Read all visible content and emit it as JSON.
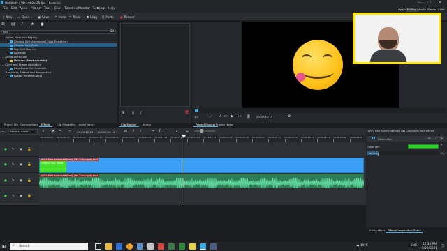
{
  "window": {
    "title": "Untitled* / HD 1080p 25 fps – Kdenlive",
    "controls": [
      "—",
      "❐",
      "✕"
    ]
  },
  "menu": [
    "File",
    "Edit",
    "View",
    "Project",
    "Tool",
    "Clip",
    "Timeline",
    "Monitor",
    "Settings",
    "Help"
  ],
  "layouts": [
    "Logging",
    "Editing",
    "Audio",
    "Effects",
    "Color"
  ],
  "toolbar": {
    "new": "New",
    "open": "Open...",
    "save": "Save",
    "undo": "Undo",
    "redo": "Redo",
    "copy": "Copy",
    "paste": "Paste",
    "render": "Render"
  },
  "effects": {
    "search_value": "key",
    "groups": [
      {
        "label": "Alpha, Mask and Keying",
        "items": [
          {
            "label": "Chroma Key: Advanced (Color Selection)",
            "color": "#3daee9",
            "selected": false
          },
          {
            "label": "Chroma Key: Basic",
            "color": "#3daee9",
            "selected": true
          },
          {
            "label": "Key Spill Mop Up",
            "color": "#3daee9",
            "selected": false
          },
          {
            "label": "Lumakey",
            "color": "#3daee9",
            "selected": false
          }
        ]
      },
      {
        "label": "Audio correction",
        "items": [
          {
            "label": "Volume (keyframable)",
            "color": "#e8c32f",
            "selected": false,
            "bold": true
          }
        ]
      },
      {
        "label": "Color and Image correction",
        "items": [
          {
            "label": "Brightness (keyframable)",
            "color": "#3daee9",
            "selected": false
          }
        ]
      },
      {
        "label": "Transform, Distort and Perspective",
        "items": [
          {
            "label": "Rotate (keyframable)",
            "color": "#3daee9",
            "selected": false
          }
        ]
      }
    ],
    "tabs": [
      "Project Bin",
      "Compositions",
      "Effects",
      "Clip Properties",
      "Undo History"
    ],
    "active_tab": "Effects"
  },
  "clip_monitor": {
    "tabs": [
      "Clip Monitor",
      "Library"
    ],
    "active_tab": "Clip Monitor"
  },
  "project_monitor": {
    "zoom": "1:1",
    "timecode": "00:00:13:19",
    "tabs": [
      "Project Monitor",
      "Project Notes"
    ],
    "active_tab": "Project Monitor"
  },
  "timeline": {
    "edit_mode": "Normal mode",
    "position": "00:00:13:13",
    "duration": "00:00:50:13",
    "ruler": [
      "00:00:00:00",
      "00:00:01:24",
      "00:00:03:23",
      "00:00:04:17",
      "00:00:06:06",
      "00:00:07:20",
      "00:00:09:09",
      "00:00:11:23",
      "00:00:12:12",
      "00:00:14:01",
      "00:00:15:15",
      "00:00:17:04",
      "00:00:18:18",
      "00:00:20:07",
      "00:00:21:21",
      "00:00:23:10",
      "00:00:24:24",
      "00:00:26:13",
      "00:00:28:02",
      "00:00:29:16"
    ],
    "tracks": [
      {
        "name": "V3",
        "type": "video"
      },
      {
        "name": "V2",
        "type": "video"
      },
      {
        "name": "V1",
        "type": "video"
      },
      {
        "name": "A1",
        "type": "audio"
      },
      {
        "name": "A2",
        "type": "audio"
      }
    ],
    "video_clip": "100+ Free Animated Emoji (No Copyright).mp4",
    "video_clip_effect": "Chroma Key: Basic",
    "audio_clip": "100+ Free Animated Emoji (No Copyright).mp4"
  },
  "effect_stack": {
    "title": "100+ Free Animated Emoji (No Copyright).mp4 effects",
    "effect_name": "Chro...asic",
    "param_color": "Color key",
    "param_variance": "Variance",
    "variance_value": "100",
    "key_color": "#2bd62b",
    "tabs": [
      "Audio Mixer",
      "Effect/Composition Stack"
    ],
    "active_tab": "Effect/Composition Stack"
  },
  "taskbar": {
    "search_placeholder": "Search",
    "weather": "19°C",
    "time": "10:35 PM",
    "date": "5/22/2021",
    "language": "ENG"
  }
}
